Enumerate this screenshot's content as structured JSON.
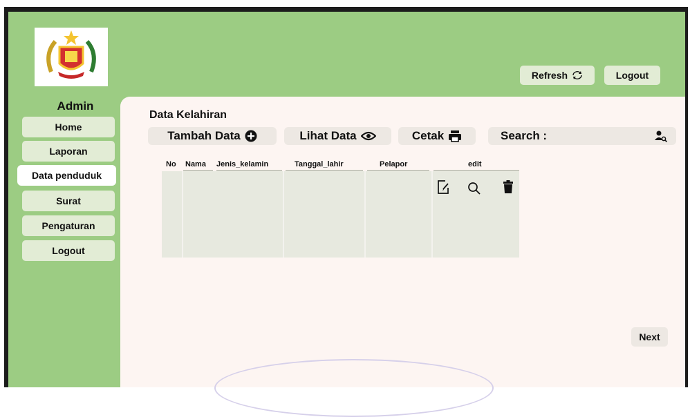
{
  "header": {
    "refresh_label": "Refresh",
    "logout_label": "Logout"
  },
  "sidebar": {
    "title": "Admin",
    "items": [
      {
        "label": "Home",
        "active": false
      },
      {
        "label": "Laporan",
        "active": false
      },
      {
        "label": "Data penduduk",
        "active": true
      },
      {
        "label": "Surat",
        "active": false
      },
      {
        "label": "Pengaturan",
        "active": false
      },
      {
        "label": "Logout",
        "active": false
      }
    ]
  },
  "main": {
    "title": "Data Kelahiran",
    "actions": {
      "add_label": "Tambah Data",
      "view_label": "Lihat Data",
      "print_label": "Cetak",
      "search_label": "Search :"
    },
    "table": {
      "columns": [
        "No",
        "Nama",
        "Jenis_kelamin",
        "Tanggal_lahir",
        "Pelapor",
        "edit"
      ],
      "row_actions": [
        "edit-icon",
        "search-icon",
        "trash-icon"
      ]
    },
    "next_label": "Next"
  },
  "colors": {
    "header_green": "#9ccc83",
    "button_bg": "#e2ecd5",
    "content_bg": "#fdf5f2",
    "table_bg": "#e7e9df"
  }
}
